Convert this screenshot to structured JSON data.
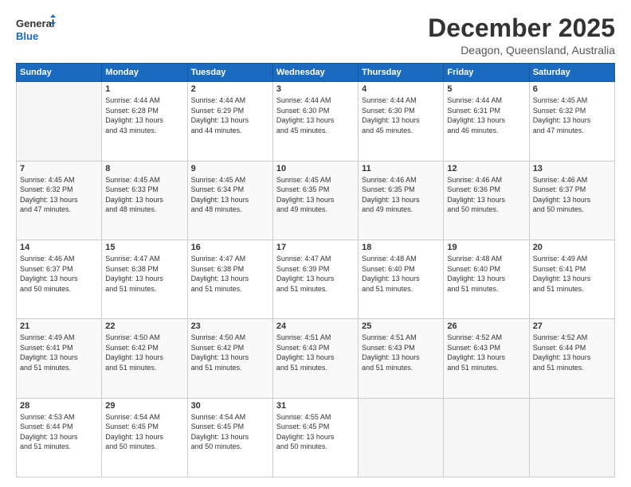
{
  "logo": {
    "line1": "General",
    "line2": "Blue"
  },
  "title": "December 2025",
  "subtitle": "Deagon, Queensland, Australia",
  "days_header": [
    "Sunday",
    "Monday",
    "Tuesday",
    "Wednesday",
    "Thursday",
    "Friday",
    "Saturday"
  ],
  "weeks": [
    [
      {
        "day": "",
        "info": ""
      },
      {
        "day": "1",
        "info": "Sunrise: 4:44 AM\nSunset: 6:28 PM\nDaylight: 13 hours\nand 43 minutes."
      },
      {
        "day": "2",
        "info": "Sunrise: 4:44 AM\nSunset: 6:29 PM\nDaylight: 13 hours\nand 44 minutes."
      },
      {
        "day": "3",
        "info": "Sunrise: 4:44 AM\nSunset: 6:30 PM\nDaylight: 13 hours\nand 45 minutes."
      },
      {
        "day": "4",
        "info": "Sunrise: 4:44 AM\nSunset: 6:30 PM\nDaylight: 13 hours\nand 45 minutes."
      },
      {
        "day": "5",
        "info": "Sunrise: 4:44 AM\nSunset: 6:31 PM\nDaylight: 13 hours\nand 46 minutes."
      },
      {
        "day": "6",
        "info": "Sunrise: 4:45 AM\nSunset: 6:32 PM\nDaylight: 13 hours\nand 47 minutes."
      }
    ],
    [
      {
        "day": "7",
        "info": "Sunrise: 4:45 AM\nSunset: 6:32 PM\nDaylight: 13 hours\nand 47 minutes."
      },
      {
        "day": "8",
        "info": "Sunrise: 4:45 AM\nSunset: 6:33 PM\nDaylight: 13 hours\nand 48 minutes."
      },
      {
        "day": "9",
        "info": "Sunrise: 4:45 AM\nSunset: 6:34 PM\nDaylight: 13 hours\nand 48 minutes."
      },
      {
        "day": "10",
        "info": "Sunrise: 4:45 AM\nSunset: 6:35 PM\nDaylight: 13 hours\nand 49 minutes."
      },
      {
        "day": "11",
        "info": "Sunrise: 4:46 AM\nSunset: 6:35 PM\nDaylight: 13 hours\nand 49 minutes."
      },
      {
        "day": "12",
        "info": "Sunrise: 4:46 AM\nSunset: 6:36 PM\nDaylight: 13 hours\nand 50 minutes."
      },
      {
        "day": "13",
        "info": "Sunrise: 4:46 AM\nSunset: 6:37 PM\nDaylight: 13 hours\nand 50 minutes."
      }
    ],
    [
      {
        "day": "14",
        "info": "Sunrise: 4:46 AM\nSunset: 6:37 PM\nDaylight: 13 hours\nand 50 minutes."
      },
      {
        "day": "15",
        "info": "Sunrise: 4:47 AM\nSunset: 6:38 PM\nDaylight: 13 hours\nand 51 minutes."
      },
      {
        "day": "16",
        "info": "Sunrise: 4:47 AM\nSunset: 6:38 PM\nDaylight: 13 hours\nand 51 minutes."
      },
      {
        "day": "17",
        "info": "Sunrise: 4:47 AM\nSunset: 6:39 PM\nDaylight: 13 hours\nand 51 minutes."
      },
      {
        "day": "18",
        "info": "Sunrise: 4:48 AM\nSunset: 6:40 PM\nDaylight: 13 hours\nand 51 minutes."
      },
      {
        "day": "19",
        "info": "Sunrise: 4:48 AM\nSunset: 6:40 PM\nDaylight: 13 hours\nand 51 minutes."
      },
      {
        "day": "20",
        "info": "Sunrise: 4:49 AM\nSunset: 6:41 PM\nDaylight: 13 hours\nand 51 minutes."
      }
    ],
    [
      {
        "day": "21",
        "info": "Sunrise: 4:49 AM\nSunset: 6:41 PM\nDaylight: 13 hours\nand 51 minutes."
      },
      {
        "day": "22",
        "info": "Sunrise: 4:50 AM\nSunset: 6:42 PM\nDaylight: 13 hours\nand 51 minutes."
      },
      {
        "day": "23",
        "info": "Sunrise: 4:50 AM\nSunset: 6:42 PM\nDaylight: 13 hours\nand 51 minutes."
      },
      {
        "day": "24",
        "info": "Sunrise: 4:51 AM\nSunset: 6:43 PM\nDaylight: 13 hours\nand 51 minutes."
      },
      {
        "day": "25",
        "info": "Sunrise: 4:51 AM\nSunset: 6:43 PM\nDaylight: 13 hours\nand 51 minutes."
      },
      {
        "day": "26",
        "info": "Sunrise: 4:52 AM\nSunset: 6:43 PM\nDaylight: 13 hours\nand 51 minutes."
      },
      {
        "day": "27",
        "info": "Sunrise: 4:52 AM\nSunset: 6:44 PM\nDaylight: 13 hours\nand 51 minutes."
      }
    ],
    [
      {
        "day": "28",
        "info": "Sunrise: 4:53 AM\nSunset: 6:44 PM\nDaylight: 13 hours\nand 51 minutes."
      },
      {
        "day": "29",
        "info": "Sunrise: 4:54 AM\nSunset: 6:45 PM\nDaylight: 13 hours\nand 50 minutes."
      },
      {
        "day": "30",
        "info": "Sunrise: 4:54 AM\nSunset: 6:45 PM\nDaylight: 13 hours\nand 50 minutes."
      },
      {
        "day": "31",
        "info": "Sunrise: 4:55 AM\nSunset: 6:45 PM\nDaylight: 13 hours\nand 50 minutes."
      },
      {
        "day": "",
        "info": ""
      },
      {
        "day": "",
        "info": ""
      },
      {
        "day": "",
        "info": ""
      }
    ]
  ]
}
